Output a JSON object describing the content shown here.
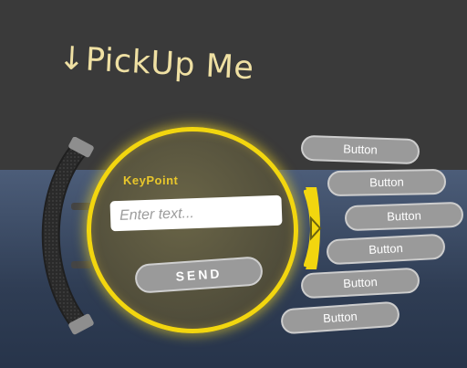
{
  "scene": {
    "pickup_label": "↓PickUp Me",
    "sky_color": "#3a3a3a",
    "floor_color": "#3f5069"
  },
  "panel": {
    "title": "KeyPoint",
    "input_placeholder": "Enter text...",
    "send_label": "SEND",
    "accent_color": "#f2d60f"
  },
  "menu": {
    "toggle_icon": "triangle-right-icon",
    "buttons": [
      {
        "label": "Button"
      },
      {
        "label": "Button"
      },
      {
        "label": "Button"
      },
      {
        "label": "Button"
      },
      {
        "label": "Button"
      },
      {
        "label": "Button"
      }
    ]
  },
  "handle": {
    "icon": "curved-grip-handle"
  }
}
